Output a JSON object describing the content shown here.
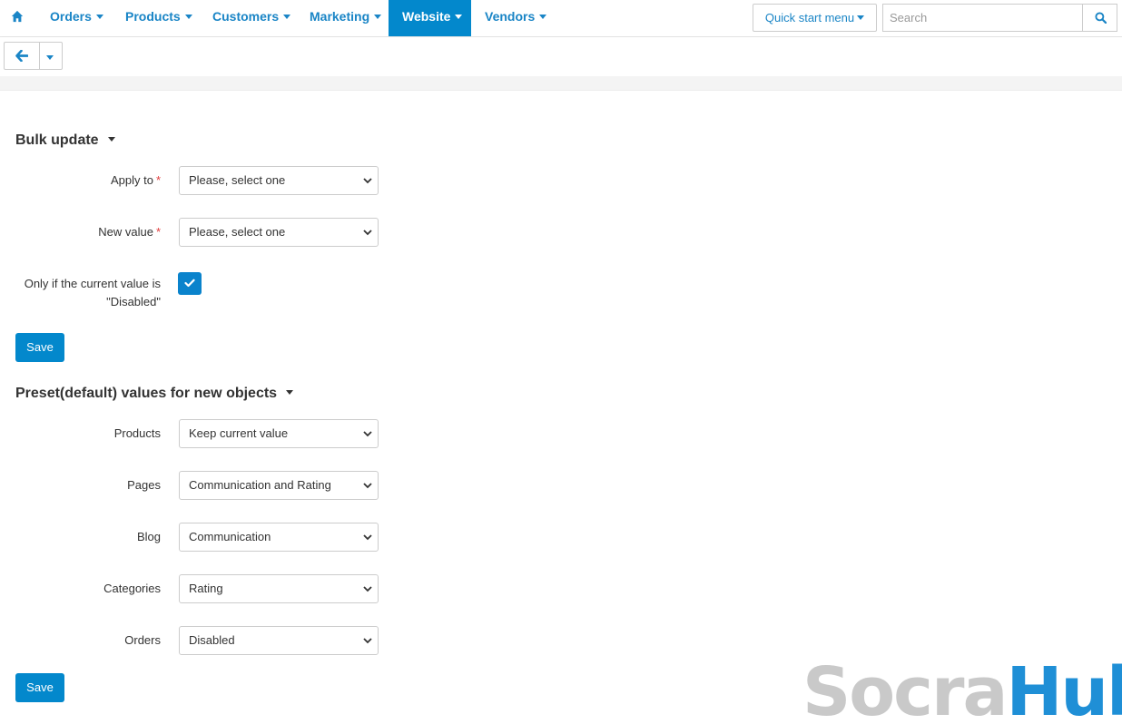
{
  "nav": {
    "items": [
      {
        "label": "Orders"
      },
      {
        "label": "Products"
      },
      {
        "label": "Customers"
      },
      {
        "label": "Marketing"
      },
      {
        "label": "Website"
      },
      {
        "label": "Vendors"
      }
    ],
    "active": "Website",
    "quick_start_label": "Quick start menu",
    "search_placeholder": "Search"
  },
  "bulk_update": {
    "title": "Bulk update",
    "apply_to": {
      "label": "Apply to",
      "value": "Please, select one"
    },
    "new_value": {
      "label": "New value",
      "value": "Please, select one"
    },
    "only_if": {
      "label": "Only if the current value is \"Disabled\"",
      "checked": true
    },
    "save_label": "Save"
  },
  "preset": {
    "title": "Preset(default) values for new objects",
    "fields": [
      {
        "label": "Products",
        "value": "Keep current value"
      },
      {
        "label": "Pages",
        "value": "Communication and Rating"
      },
      {
        "label": "Blog",
        "value": "Communication"
      },
      {
        "label": "Categories",
        "value": "Rating"
      },
      {
        "label": "Orders",
        "value": "Disabled"
      }
    ],
    "save_label": "Save"
  },
  "watermark": {
    "part1": "Socra",
    "part2": "Hub"
  },
  "colors": {
    "accent": "#0388cc",
    "link": "#1a85c6",
    "required": "#e03a3a"
  }
}
